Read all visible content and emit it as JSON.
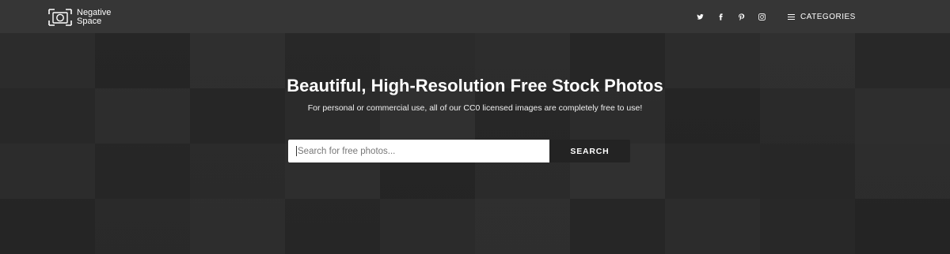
{
  "header": {
    "logo_line1": "Negative",
    "logo_line2": "Space",
    "social": [
      {
        "icon": "twitter-icon"
      },
      {
        "icon": "facebook-icon"
      },
      {
        "icon": "pinterest-icon"
      },
      {
        "icon": "instagram-icon"
      }
    ],
    "categories_label": "CATEGORIES"
  },
  "hero": {
    "headline": "Beautiful, High-Resolution Free Stock Photos",
    "subline": "For personal or commercial use, all of our CC0 licensed images are completely free to use!"
  },
  "search": {
    "placeholder": "Search for free photos...",
    "value": "",
    "button_label": "SEARCH"
  },
  "colors": {
    "navbar_bg": "#363636",
    "hero_bg": "#262626",
    "search_button_bg": "#232323",
    "text": "#ffffff"
  }
}
